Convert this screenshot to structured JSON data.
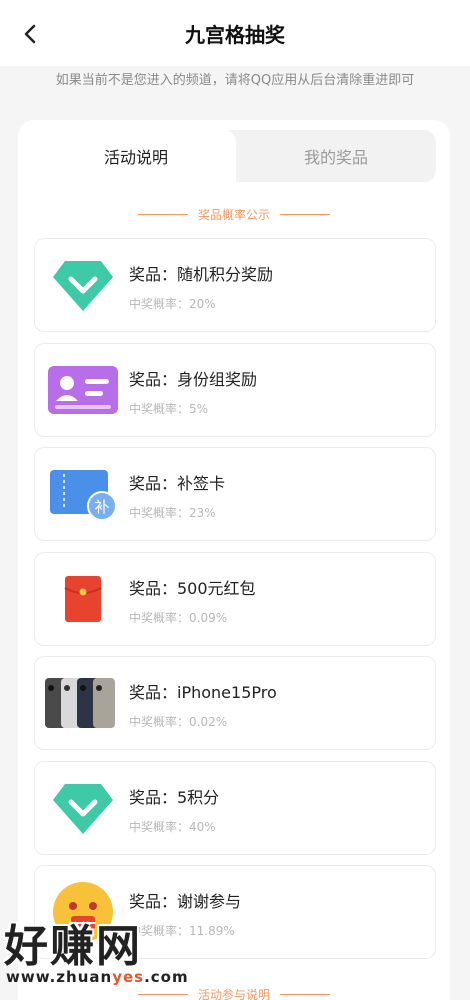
{
  "header": {
    "title": "九宫格抽奖",
    "back_icon": "chevron-left-icon"
  },
  "hint": "如果当前不是您进入的频道，请将QQ应用从后台清除重进即可",
  "tabs": [
    {
      "label": "活动说明",
      "active": true
    },
    {
      "label": "我的奖品",
      "active": false
    }
  ],
  "section_prob": "奖品概率公示",
  "section_rules": "活动参与说明",
  "prizes": [
    {
      "name": "奖品：随机积分奖励",
      "rate": "中奖概率：20%",
      "icon": "green-diamond-icon"
    },
    {
      "name": "奖品：身份组奖励",
      "rate": "中奖概率：5%",
      "icon": "id-card-icon"
    },
    {
      "name": "奖品：补签卡",
      "rate": "中奖概率：23%",
      "icon": "makeup-card-icon"
    },
    {
      "name": "奖品：500元红包",
      "rate": "中奖概率：0.09%",
      "icon": "red-envelope-icon"
    },
    {
      "name": "奖品：iPhone15Pro",
      "rate": "中奖概率：0.02%",
      "icon": "iphone-icon"
    },
    {
      "name": "奖品：5积分",
      "rate": "中奖概率：40%",
      "icon": "green-diamond-icon"
    },
    {
      "name": "奖品：谢谢参与",
      "rate": "中奖概率：11.89%",
      "icon": "face-icon"
    }
  ],
  "watermark": {
    "text": "好赚网",
    "url_prefix": "www.zhuan",
    "url_highlight": "yes",
    "url_suffix": ".com"
  },
  "colors": {
    "accent": "#f29a64",
    "green": "#3ec9a7",
    "purple": "#b86ee8",
    "blue": "#4a90e8",
    "red": "#e8432f"
  }
}
